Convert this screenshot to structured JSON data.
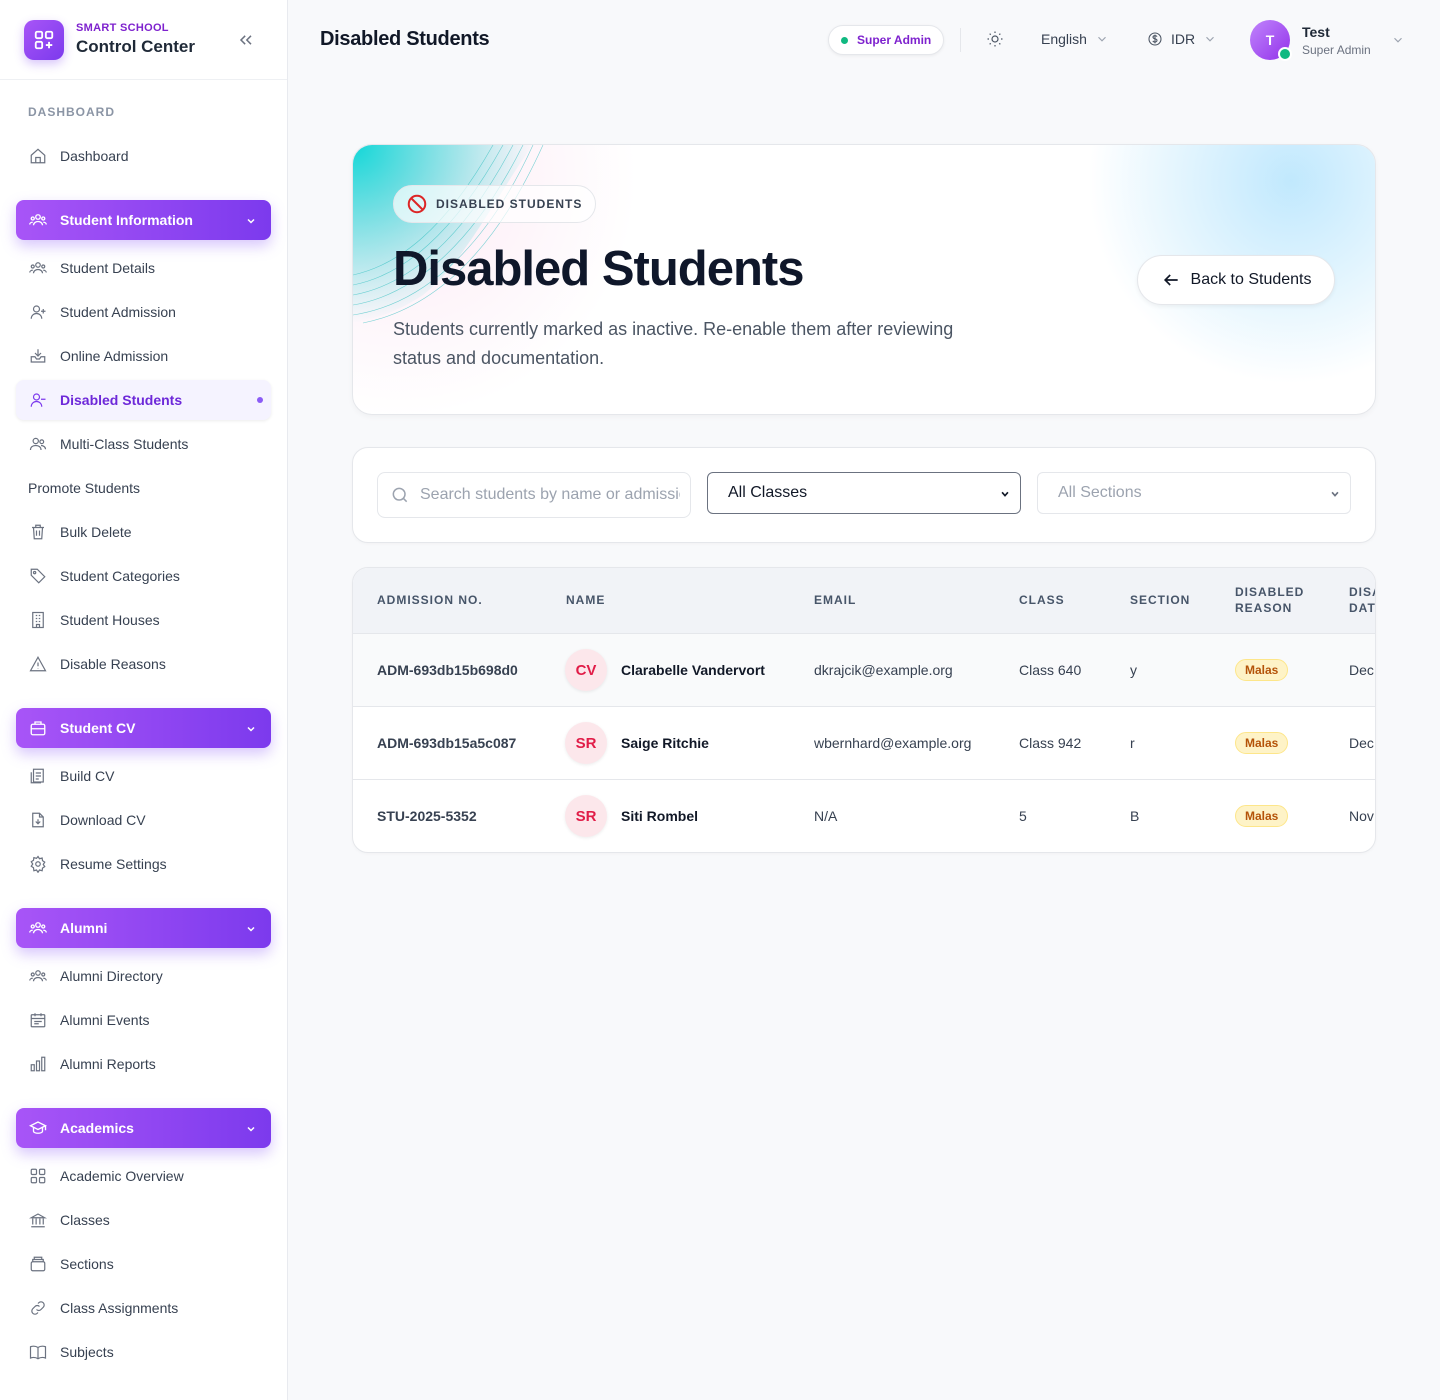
{
  "brand": {
    "top": "SMART SCHOOL",
    "main": "Control Center"
  },
  "sidebar": {
    "section_label": "DASHBOARD",
    "dashboard": "Dashboard",
    "groups": {
      "student_info": "Student Information",
      "student_cv": "Student CV",
      "alumni": "Alumni",
      "academics": "Academics"
    },
    "items": {
      "student_details": "Student Details",
      "student_admission": "Student Admission",
      "online_admission": "Online Admission",
      "disabled_students": "Disabled Students",
      "multi_class": "Multi-Class Students",
      "promote": "Promote Students",
      "bulk_delete": "Bulk Delete",
      "categories": "Student Categories",
      "houses": "Student Houses",
      "disable_reasons": "Disable Reasons",
      "build_cv": "Build CV",
      "download_cv": "Download CV",
      "resume_settings": "Resume Settings",
      "alumni_directory": "Alumni Directory",
      "alumni_events": "Alumni Events",
      "alumni_reports": "Alumni Reports",
      "academic_overview": "Academic Overview",
      "classes": "Classes",
      "sections": "Sections",
      "class_assignments": "Class Assignments",
      "subjects": "Subjects"
    }
  },
  "header": {
    "title": "Disabled Students",
    "role_pill": "Super Admin",
    "language": "English",
    "currency": "IDR",
    "user_initial": "T",
    "user_name": "Test",
    "user_role": "Super Admin"
  },
  "hero": {
    "badge": "DISABLED STUDENTS",
    "title": "Disabled Students",
    "description": "Students currently marked as inactive. Re-enable them after reviewing status and documentation.",
    "back_button": "Back to Students"
  },
  "filters": {
    "search_placeholder": "Search students by name or admission",
    "class_select": "All Classes",
    "section_select": "All Sections"
  },
  "table": {
    "headers": {
      "admission": "ADMISSION NO.",
      "name": "NAME",
      "email": "EMAIL",
      "class": "CLASS",
      "section": "SECTION",
      "reason_1": "DISABLED",
      "reason_2": "REASON",
      "date_1": "DISA",
      "date_2": "DAT"
    },
    "rows": [
      {
        "admission": "ADM-693db15b698d0",
        "initials": "CV",
        "name": "Clarabelle Vandervort",
        "email": "dkrajcik@example.org",
        "class": "Class 640",
        "section": "y",
        "reason": "Malas",
        "date": "Dec"
      },
      {
        "admission": "ADM-693db15a5c087",
        "initials": "SR",
        "name": "Saige Ritchie",
        "email": "wbernhard@example.org",
        "class": "Class 942",
        "section": "r",
        "reason": "Malas",
        "date": "Dec"
      },
      {
        "admission": "STU-2025-5352",
        "initials": "SR",
        "name": "Siti Rombel",
        "email": "N/A",
        "class": "5",
        "section": "B",
        "reason": "Malas",
        "date": "Nov"
      }
    ]
  },
  "colors": {
    "accent": "#7c3aed",
    "online": "#10b981",
    "badge": "#b45309"
  }
}
